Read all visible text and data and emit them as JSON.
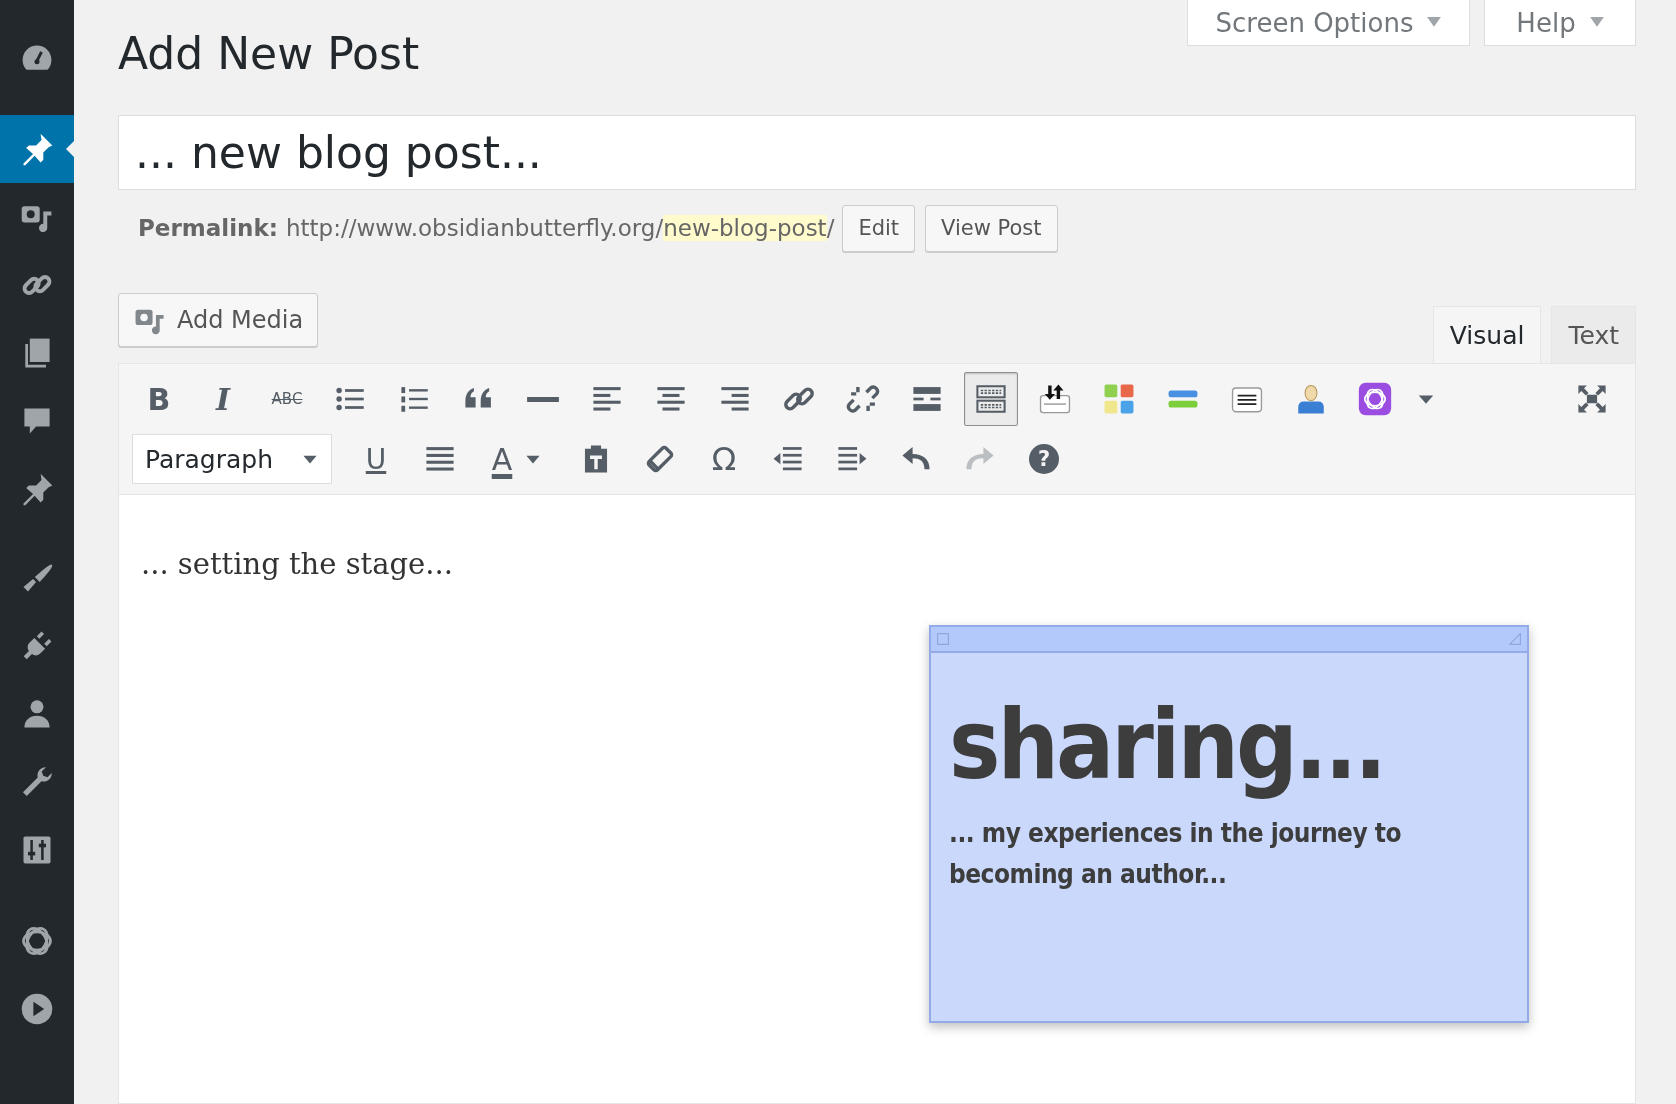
{
  "sidebar": {
    "items": [
      {
        "selected": false
      },
      {
        "selected": true
      },
      {
        "selected": false
      },
      {
        "selected": false
      },
      {
        "selected": false
      },
      {
        "selected": false
      },
      {
        "selected": false
      },
      {
        "selected": false
      },
      {
        "selected": false
      },
      {
        "selected": false
      },
      {
        "selected": false
      },
      {
        "selected": false
      },
      {
        "selected": false
      },
      {
        "selected": false
      }
    ]
  },
  "header": {
    "title": "Add New Post",
    "screen_options": "Screen Options",
    "help": "Help"
  },
  "post_title": {
    "value": "... new blog post..."
  },
  "permalink": {
    "label": "Permalink:",
    "base": "http://www.obsidianbutterfly.org/",
    "slug": "new-blog-post",
    "trailing": "/",
    "buttons": [
      "Edit",
      "View Post"
    ]
  },
  "add_media": "Add Media",
  "editor_tabs": [
    {
      "label": "Visual",
      "selected": true
    },
    {
      "label": "Text",
      "selected": false
    }
  ],
  "toolbar": {
    "row_1": [
      {
        "kind": "bold",
        "glyph": "B",
        "pressed": false,
        "disabled": false
      },
      {
        "kind": "italic",
        "glyph": "I",
        "pressed": false,
        "disabled": false
      },
      {
        "kind": "strikethrough",
        "glyph": "ABC",
        "pressed": false,
        "disabled": false
      },
      {
        "kind": "bullets",
        "pressed": false,
        "disabled": false
      },
      {
        "kind": "numbers",
        "pressed": false,
        "disabled": false
      },
      {
        "kind": "quote",
        "pressed": false,
        "disabled": false
      },
      {
        "kind": "rule",
        "pressed": false,
        "disabled": false
      },
      {
        "kind": "align_left",
        "pressed": false,
        "disabled": false
      },
      {
        "kind": "align_center",
        "pressed": false,
        "disabled": false
      },
      {
        "kind": "align_right",
        "pressed": false,
        "disabled": false
      },
      {
        "kind": "link",
        "pressed": false,
        "disabled": false
      },
      {
        "kind": "unlink",
        "pressed": false,
        "disabled": false
      },
      {
        "kind": "more",
        "pressed": false,
        "disabled": false
      },
      {
        "kind": "kitchen_sink",
        "pressed": true,
        "disabled": false
      },
      {
        "kind": "upload",
        "pressed": false,
        "disabled": false
      },
      {
        "kind": "tiles",
        "pressed": false,
        "disabled": false
      },
      {
        "kind": "bars",
        "pressed": false,
        "disabled": false
      },
      {
        "kind": "notepad",
        "pressed": false,
        "disabled": false
      },
      {
        "kind": "person",
        "pressed": false,
        "disabled": false
      },
      {
        "kind": "ring",
        "pressed": false,
        "disabled": false
      },
      {
        "kind": "caret",
        "pressed": false,
        "disabled": false
      },
      {
        "kind": "fullscreen",
        "pressed": false,
        "disabled": false
      }
    ],
    "row_2": [
      {
        "kind": "format",
        "value": "Paragraph"
      },
      {
        "kind": "underline",
        "glyph": "U",
        "pressed": false,
        "disabled": false
      },
      {
        "kind": "justify",
        "pressed": false,
        "disabled": false
      },
      {
        "kind": "text_color",
        "glyph": "A",
        "pressed": false,
        "disabled": false
      },
      {
        "kind": "paste_text",
        "pressed": false,
        "disabled": false
      },
      {
        "kind": "eraser",
        "pressed": false,
        "disabled": false
      },
      {
        "kind": "symbol",
        "glyph": "Ω",
        "pressed": false,
        "disabled": false
      },
      {
        "kind": "outdent",
        "pressed": false,
        "disabled": false
      },
      {
        "kind": "indent",
        "pressed": false,
        "disabled": false
      },
      {
        "kind": "undo",
        "pressed": false,
        "disabled": false
      },
      {
        "kind": "redo",
        "pressed": false,
        "disabled": true
      },
      {
        "kind": "help",
        "glyph": "?",
        "pressed": false,
        "disabled": false
      }
    ]
  },
  "content": {
    "paragraph": "... setting the stage..."
  },
  "sticky_note": {
    "heading": "sharing...",
    "body": "...  my experiences in the journey to becoming an author..."
  }
}
